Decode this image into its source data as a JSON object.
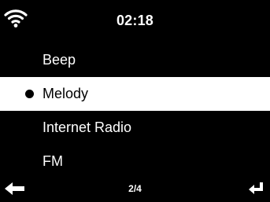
{
  "status": {
    "time": "02:18",
    "wifi_icon": "wifi-icon"
  },
  "menu": {
    "items": [
      {
        "label": "Beep",
        "selected": false
      },
      {
        "label": "Melody",
        "selected": true
      },
      {
        "label": "Internet Radio",
        "selected": false
      },
      {
        "label": "FM",
        "selected": false
      }
    ]
  },
  "footer": {
    "back_icon": "back-arrow-icon",
    "page": "2/4",
    "enter_icon": "enter-icon"
  },
  "colors": {
    "background": "#000000",
    "foreground": "#ffffff",
    "highlight": "#ffffff"
  }
}
